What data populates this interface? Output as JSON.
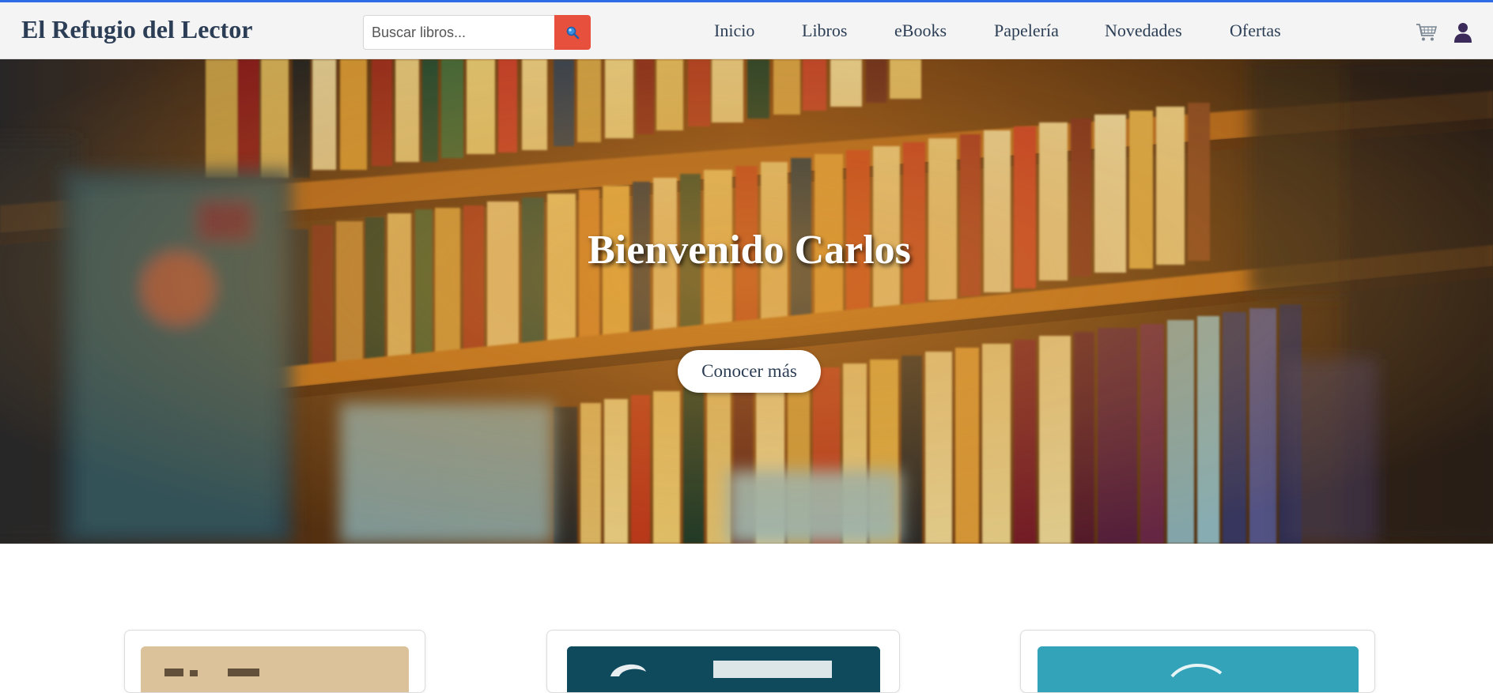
{
  "header": {
    "logo": "El Refugio del Lector",
    "search": {
      "placeholder": "Buscar libros...",
      "value": ""
    },
    "nav": [
      {
        "label": "Inicio"
      },
      {
        "label": "Libros"
      },
      {
        "label": "eBooks"
      },
      {
        "label": "Papelería"
      },
      {
        "label": "Novedades"
      },
      {
        "label": "Ofertas"
      }
    ]
  },
  "hero": {
    "title": "Bienvenido Carlos",
    "cta_label": "Conocer más"
  },
  "icons": {
    "search": "search-icon",
    "cart": "cart-icon",
    "user": "user-icon"
  },
  "colors": {
    "brand_text": "#2c3e55",
    "accent": "#e8503e",
    "top_border": "#2e6be6",
    "header_bg": "#f4f4f4"
  }
}
